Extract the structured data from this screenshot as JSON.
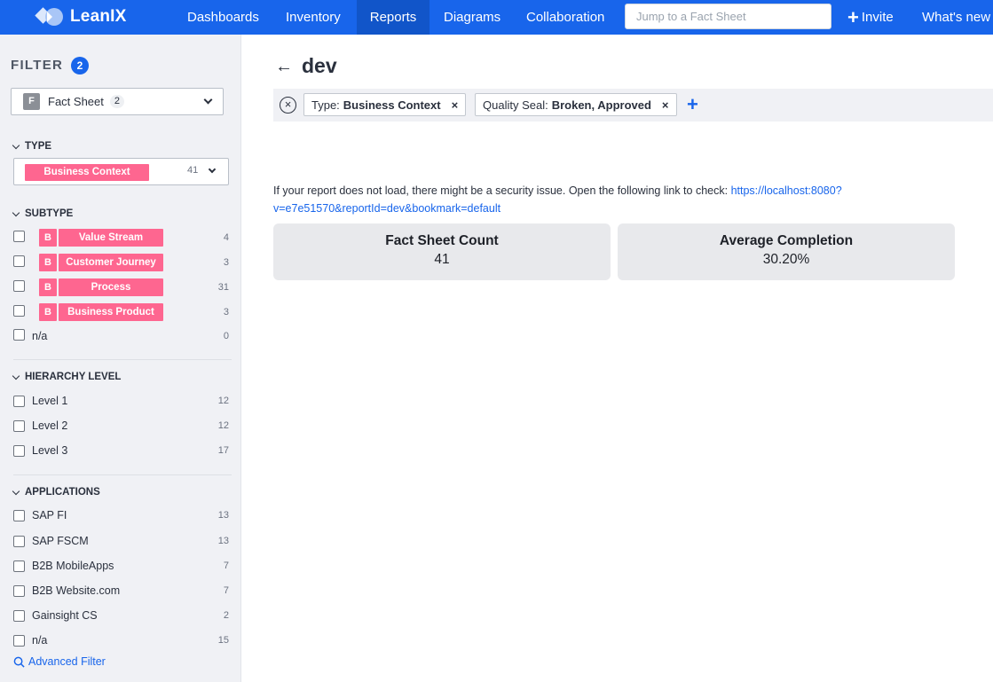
{
  "app": {
    "logo_text": "LeanIX",
    "nav": [
      {
        "label": "Dashboards",
        "active": false
      },
      {
        "label": "Inventory",
        "active": false
      },
      {
        "label": "Reports",
        "active": true
      },
      {
        "label": "Diagrams",
        "active": false
      },
      {
        "label": "Collaboration",
        "active": false
      }
    ],
    "search_placeholder": "Jump to a Fact Sheet",
    "invite_label": "Invite",
    "whats_new_label": "What's new",
    "brand_color": "#1865eb"
  },
  "sidebar": {
    "title": "FILTER",
    "badge": "2",
    "factsheet_select": {
      "icon": "F",
      "label": "Fact Sheet",
      "count": "2"
    },
    "type": {
      "header": "TYPE",
      "selected": "Business Context",
      "count": "41",
      "tag_color": "#fe6690"
    },
    "subtype": {
      "header": "SUBTYPE",
      "items": [
        {
          "prefix": "B",
          "label": "Value Stream",
          "count": "4"
        },
        {
          "prefix": "B",
          "label": "Customer Journey",
          "count": "3"
        },
        {
          "prefix": "B",
          "label": "Process",
          "count": "31"
        },
        {
          "prefix": "B",
          "label": "Business Product",
          "count": "3"
        }
      ],
      "na": {
        "label": "n/a",
        "count": "0"
      }
    },
    "hierarchy": {
      "header": "HIERARCHY LEVEL",
      "items": [
        {
          "label": "Level 1",
          "count": "12"
        },
        {
          "label": "Level 2",
          "count": "12"
        },
        {
          "label": "Level 3",
          "count": "17"
        }
      ]
    },
    "applications": {
      "header": "APPLICATIONS",
      "items": [
        {
          "label": "SAP FI",
          "count": "13"
        },
        {
          "label": "SAP FSCM",
          "count": "13"
        },
        {
          "label": "B2B MobileApps",
          "count": "7"
        },
        {
          "label": "B2B Website.com",
          "count": "7"
        },
        {
          "label": "Gainsight CS",
          "count": "2"
        },
        {
          "label": "n/a",
          "count": "15"
        }
      ]
    },
    "advanced_filter": "Advanced Filter"
  },
  "main": {
    "title": "dev",
    "chips": [
      {
        "key": "Type:",
        "value": "Business Context"
      },
      {
        "key": "Quality Seal:",
        "value": "Broken, Approved"
      }
    ],
    "notice_text": "If your report does not load, there might be a security issue. Open the following link to check: ",
    "notice_link": "https://localhost:8080?v=e7e51570&reportId=dev&bookmark=default",
    "kpis": [
      {
        "title": "Fact Sheet Count",
        "value": "41"
      },
      {
        "title": "Average Completion",
        "value": "30.20%"
      }
    ]
  }
}
